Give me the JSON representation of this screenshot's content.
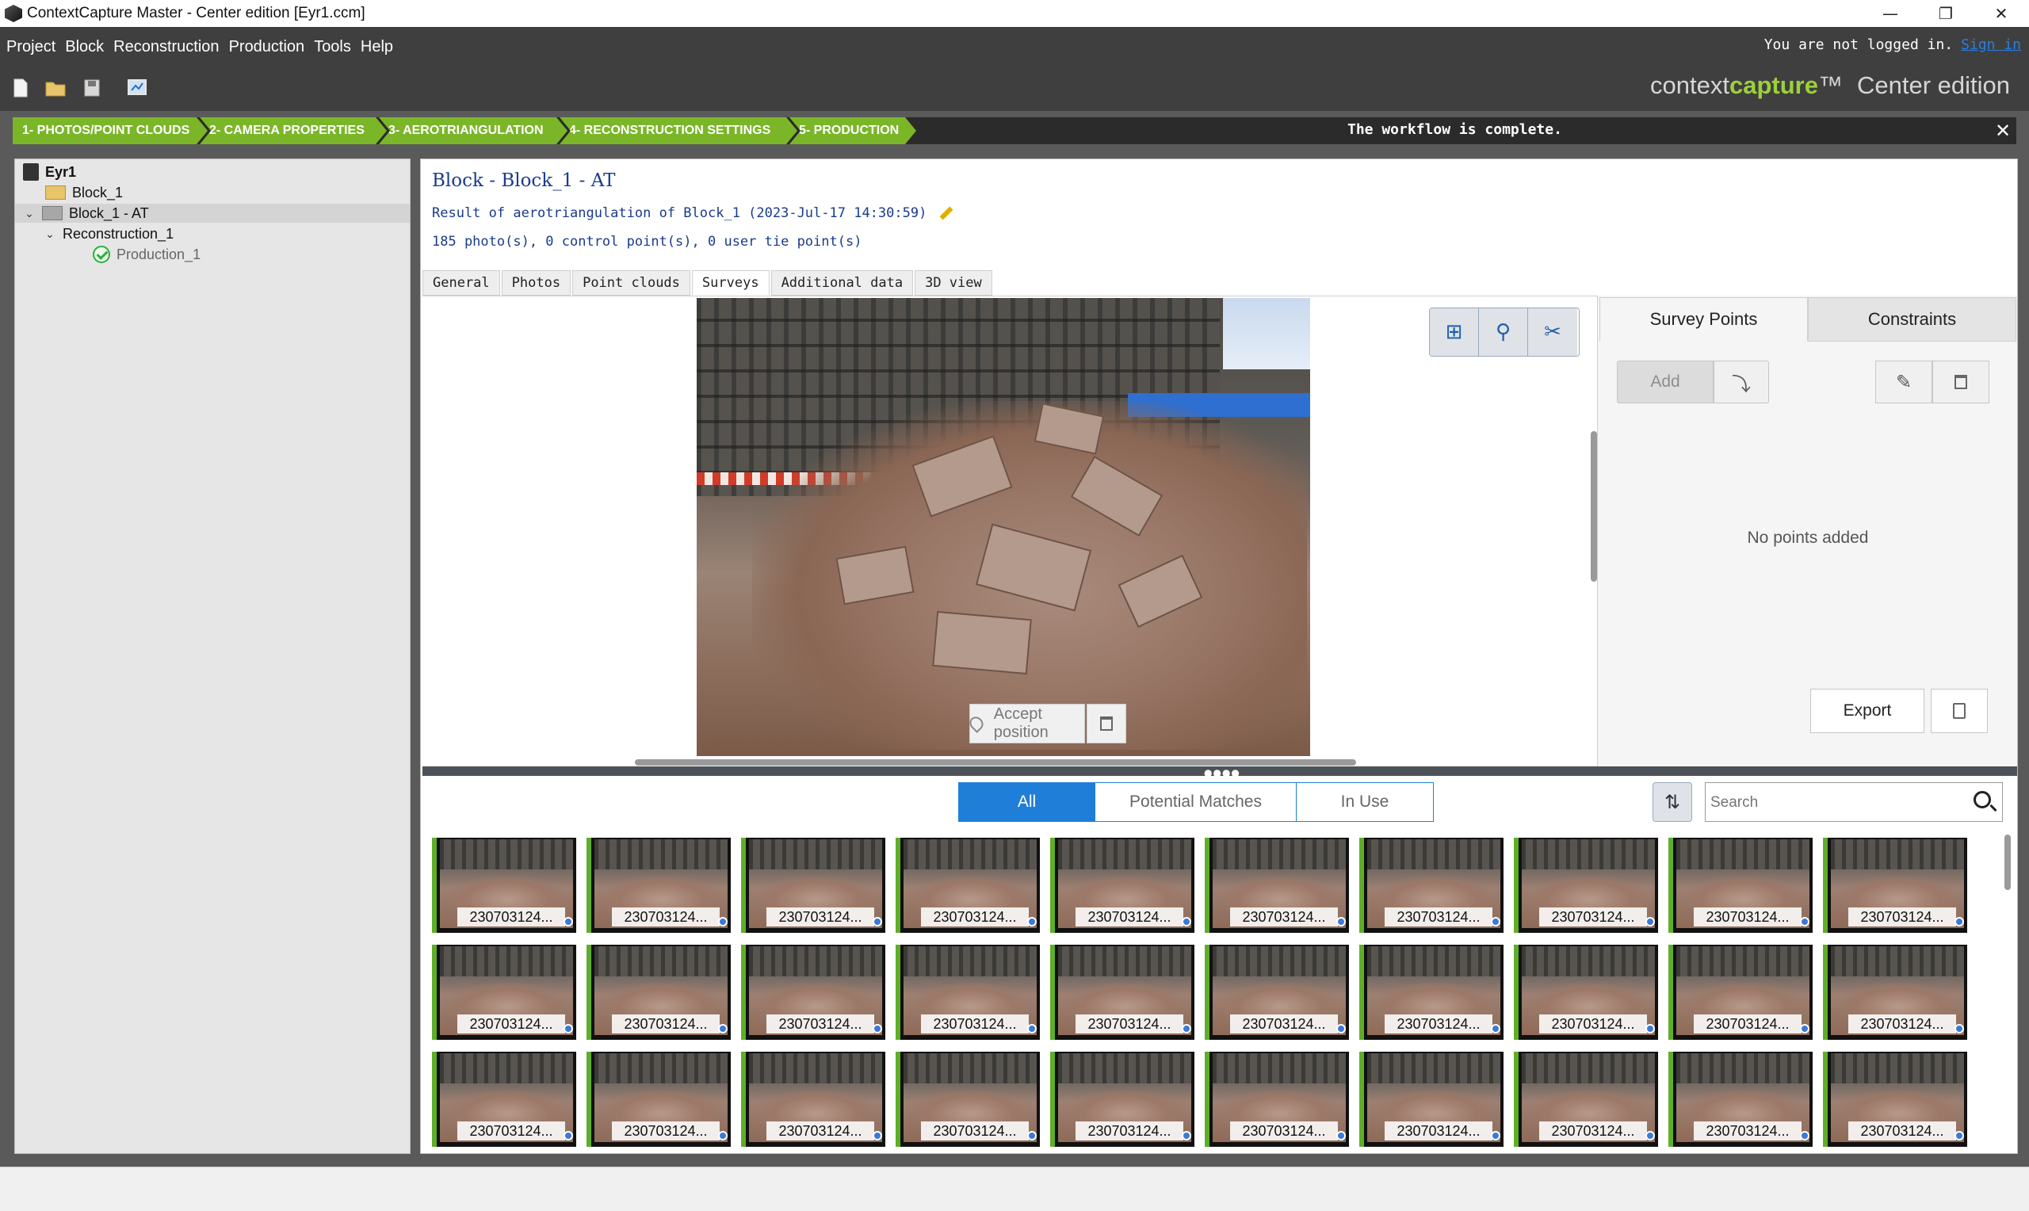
{
  "window": {
    "title": "ContextCapture Master - Center edition [Eyr1.ccm]",
    "minimize": "—",
    "restore": "❐",
    "close": "✕"
  },
  "menu": [
    "Project",
    "Block",
    "Reconstruction",
    "Production",
    "Tools",
    "Help"
  ],
  "login": {
    "text": "You are not logged in.",
    "link": "Sign in"
  },
  "brand": {
    "context": "context",
    "capture": "capture",
    "tm": "™",
    "edition": "Center edition"
  },
  "workflow": {
    "steps": [
      "1- PHOTOS/POINT CLOUDS",
      "2- CAMERA PROPERTIES",
      "3- AEROTRIANGULATION",
      "4- RECONSTRUCTION SETTINGS",
      "5- PRODUCTION"
    ],
    "message": "The workflow is complete.",
    "close": "✕"
  },
  "tree": {
    "project": "Eyr1",
    "block": "Block_1",
    "block_at": "Block_1 - AT",
    "reconstruction": "Reconstruction_1",
    "production": "Production_1",
    "expand": "⌄"
  },
  "block_info": {
    "title": "Block - Block_1 - AT",
    "result": "Result of aerotriangulation of Block_1 (2023-Jul-17 14:30:59)",
    "summary": "185 photo(s), 0 control point(s), 0 user tie point(s)"
  },
  "tabs": [
    "General",
    "Photos",
    "Point clouds",
    "Surveys",
    "Additional data",
    "3D view"
  ],
  "active_tab": "Surveys",
  "viewer": {
    "accept": "Accept position",
    "tools": [
      "⊞",
      "⚲",
      "✂"
    ]
  },
  "survey": {
    "tabs": [
      "Survey Points",
      "Constraints"
    ],
    "add": "Add",
    "import_icon": "⤵",
    "edit_icon": "✎",
    "empty": "No points added",
    "export": "Export"
  },
  "filters": [
    "All",
    "Potential Matches",
    "In Use"
  ],
  "search": {
    "placeholder": "Search"
  },
  "sort_icon": "⇅",
  "splitter_grip": "●●●●",
  "thumbnails": [
    "230703124...",
    "230703124...",
    "230703124...",
    "230703124...",
    "230703124...",
    "230703124...",
    "230703124...",
    "230703124...",
    "230703124...",
    "230703124...",
    "230703124...",
    "230703124...",
    "230703124...",
    "230703124...",
    "230703124...",
    "230703124...",
    "230703124...",
    "230703124...",
    "230703124...",
    "230703124...",
    "230703124...",
    "230703124...",
    "230703124...",
    "230703124...",
    "230703124...",
    "230703124...",
    "230703124...",
    "230703124...",
    "230703124...",
    "230703124..."
  ],
  "colors": {
    "workflow_green": "#7bb628",
    "brand_green": "#9bd13a",
    "filter_blue": "#1f7fd8",
    "info_blue": "#1a3a8c"
  }
}
